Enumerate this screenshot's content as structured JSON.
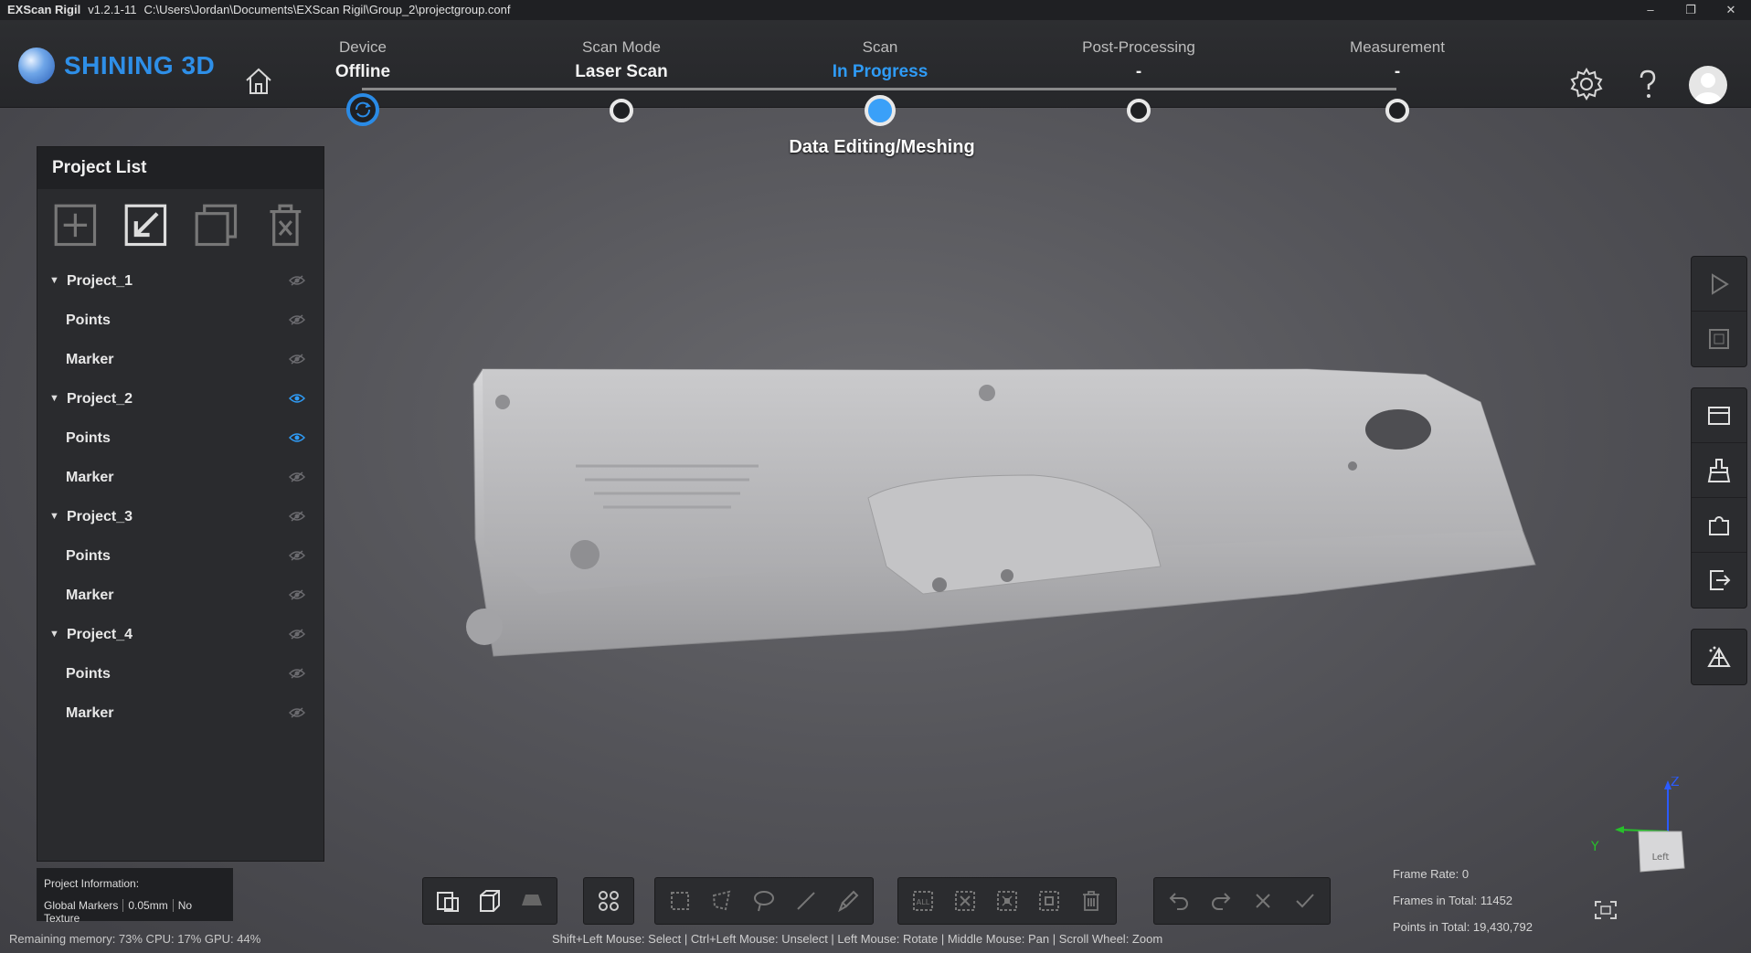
{
  "titlebar": {
    "app": "EXScan Rigil",
    "version": "v1.2.1-11",
    "path": "C:\\Users\\Jordan\\Documents\\EXScan Rigil\\Group_2\\projectgroup.conf",
    "controls": [
      "–",
      "❐",
      "✕"
    ]
  },
  "header": {
    "logo_text": "SHINING 3D",
    "steps": [
      {
        "caption": "Device",
        "value": "Offline"
      },
      {
        "caption": "Scan Mode",
        "value": "Laser Scan"
      },
      {
        "caption": "Scan",
        "value": "In Progress"
      },
      {
        "caption": "Post-Processing",
        "value": "-"
      },
      {
        "caption": "Measurement",
        "value": "-"
      }
    ],
    "stage_label": "Data Editing/Meshing",
    "accent": "#2f9bf5"
  },
  "project_panel": {
    "title": "Project List",
    "rows": [
      {
        "label": "Project_1",
        "type": "project",
        "visible": false
      },
      {
        "label": "Points",
        "type": "child",
        "visible": false
      },
      {
        "label": "Marker",
        "type": "child",
        "visible": false
      },
      {
        "label": "Project_2",
        "type": "project",
        "visible": true
      },
      {
        "label": "Points",
        "type": "child",
        "visible": true
      },
      {
        "label": "Marker",
        "type": "child",
        "visible": false
      },
      {
        "label": "Project_3",
        "type": "project",
        "visible": false
      },
      {
        "label": "Points",
        "type": "child",
        "visible": false
      },
      {
        "label": "Marker",
        "type": "child",
        "visible": false
      },
      {
        "label": "Project_4",
        "type": "project",
        "visible": false
      },
      {
        "label": "Points",
        "type": "child",
        "visible": false
      },
      {
        "label": "Marker",
        "type": "child",
        "visible": false
      }
    ]
  },
  "project_info": {
    "title": "Project Information:",
    "tags": [
      "Global Markers",
      "0.05mm",
      "No Texture"
    ]
  },
  "stats": {
    "frame_rate": "Frame Rate: 0",
    "frames_total": "Frames in Total: 11452",
    "points_total": "Points in Total: 19,430,792"
  },
  "status": {
    "resources": "Remaining memory: 73% CPU: 17% GPU: 44%",
    "hint": "Shift+Left Mouse: Select | Ctrl+Left Mouse: Unselect | Left Mouse: Rotate | Middle Mouse: Pan | Scroll Wheel: Zoom"
  },
  "viewport": {
    "axis_x_label": "Y",
    "axis_z_label": "Z",
    "cube_face": "Left"
  }
}
